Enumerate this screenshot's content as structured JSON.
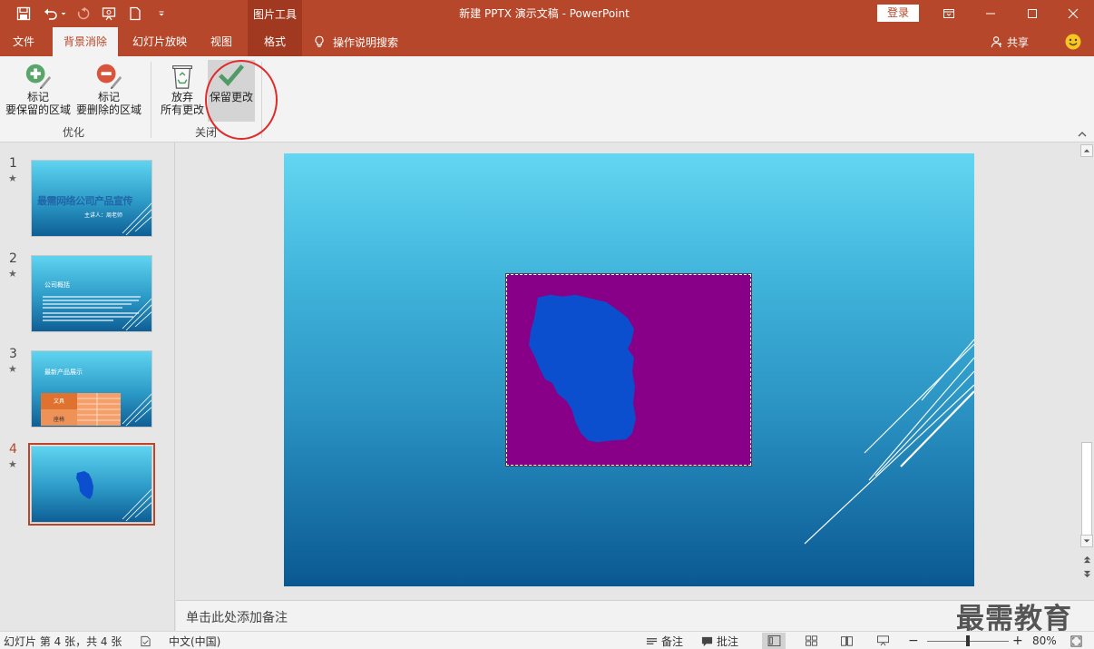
{
  "app": {
    "title": "新建 PPTX 演示文稿  -  PowerPoint",
    "contextual_tab_group": "图片工具",
    "login_label": "登录",
    "accent_color": "#b7472a"
  },
  "quick_access": {
    "icons": [
      "save-icon",
      "undo-icon",
      "redo-icon",
      "slideshow-from-start-icon",
      "new-document-icon",
      "customize-qat-icon"
    ]
  },
  "tabs": [
    {
      "label": "文件",
      "active": false
    },
    {
      "label": "背景消除",
      "active": true
    },
    {
      "label": "幻灯片放映",
      "active": false
    },
    {
      "label": "视图",
      "active": false
    },
    {
      "label": "格式",
      "active": false
    }
  ],
  "tell_me": {
    "label": "操作说明搜索"
  },
  "share": {
    "label": "共享"
  },
  "ribbon": {
    "groups": [
      {
        "label": "优化",
        "buttons": [
          {
            "line1": "标记",
            "line2": "要保留的区域",
            "icon": "mark-keep-plus-icon"
          },
          {
            "line1": "标记",
            "line2": "要删除的区域",
            "icon": "mark-remove-minus-icon"
          }
        ]
      },
      {
        "label": "关闭",
        "buttons": [
          {
            "line1": "放弃",
            "line2": "所有更改",
            "icon": "recycle-bin-icon"
          },
          {
            "line1": "保留更改",
            "line2": "",
            "icon": "checkmark-icon"
          }
        ]
      }
    ]
  },
  "slides": [
    {
      "number": "1",
      "title": "最需网络公司产品宣传",
      "subtitle": "主讲人：周老师"
    },
    {
      "number": "2",
      "title": "公司概括"
    },
    {
      "number": "3",
      "title": "最新产品展示",
      "table_labels": [
        "文具",
        "座椅"
      ]
    },
    {
      "number": "4",
      "title": ""
    }
  ],
  "current_slide": 4,
  "notes": {
    "placeholder": "单击此处添加备注"
  },
  "watermark": "最需教育",
  "status": {
    "slide_info": "幻灯片 第 4 张，共 4 张",
    "language": "中文(中国)",
    "notes_label": "备注",
    "comments_label": "批注",
    "zoom": "80%",
    "zoom_fraction": 0.5
  },
  "colors": {
    "picture_background": "#880088",
    "object_blue": "#0b4fcf"
  }
}
